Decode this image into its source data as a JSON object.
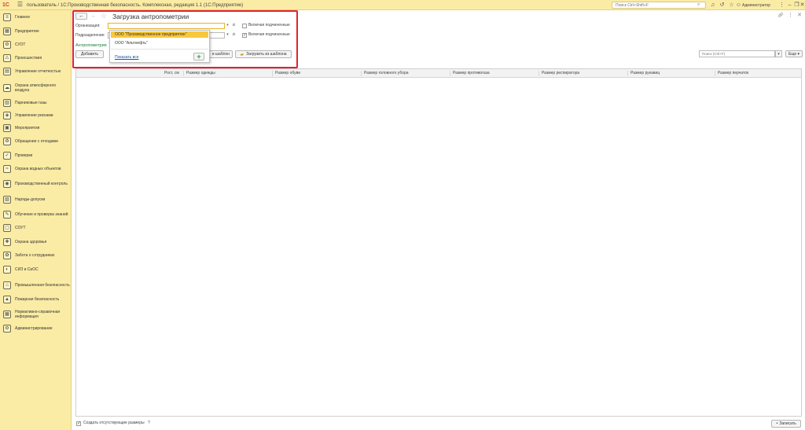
{
  "topbar": {
    "logo": "1С",
    "title": "пользователь / 1С:Производственная безопасность. Комплексная, редакция 1.1  (1С:Предприятие)",
    "search_placeholder": "Поиск Ctrl+Shift+F",
    "user": "Администратор"
  },
  "sidebar": {
    "items": [
      {
        "label": "Главное",
        "icon": "≡"
      },
      {
        "label": "Предприятие",
        "icon": "▦"
      },
      {
        "label": "СУОТ",
        "icon": "⚙"
      },
      {
        "label": "Происшествия",
        "icon": "⚠"
      },
      {
        "label": "Управление отчетностью",
        "icon": "▤"
      },
      {
        "label": "Охрана атмосферного воздуха",
        "icon": "☁"
      },
      {
        "label": "Парниковые газы",
        "icon": "▥"
      },
      {
        "label": "Управление рисками",
        "icon": "◈"
      },
      {
        "label": "Мероприятия",
        "icon": "▣"
      },
      {
        "label": "Обращение с отходами",
        "icon": "♻"
      },
      {
        "label": "Проверки",
        "icon": "✓"
      },
      {
        "label": "Охрана водных объектов",
        "icon": "≈"
      },
      {
        "label": "Производственный контроль",
        "icon": "◉"
      },
      {
        "label": "Наряды-допуски",
        "icon": "▧"
      },
      {
        "label": "Обучение и проверка знаний",
        "icon": "✎"
      },
      {
        "label": "СОУТ",
        "icon": "▢"
      },
      {
        "label": "Охрана здоровья",
        "icon": "✚"
      },
      {
        "label": "Забота о сотрудниках",
        "icon": "✿"
      },
      {
        "label": "СИЗ и СиОС",
        "icon": "◐"
      },
      {
        "label": "Промышленная безопасность",
        "icon": "⌂"
      },
      {
        "label": "Пожарная безопасность",
        "icon": "▲"
      },
      {
        "label": "Нормативно-справочная информация",
        "icon": "▦"
      },
      {
        "label": "Администрирование",
        "icon": "⚙"
      }
    ]
  },
  "form": {
    "title": "Загрузка антропометрии",
    "org_label": "Организация:",
    "org_value": "",
    "dept_label": "Подразделение:",
    "include_sub_1": "Включая подчиненные",
    "include_sub_2": "Включая подчиненные",
    "section_link": "Антропометрия",
    "add_button": "Добавить",
    "save_template": "в шаблон",
    "load_template": "Загрузить из шаблона",
    "table_search_placeholder": "Поиск (Ctrl+F)",
    "more_button": "Еще"
  },
  "dropdown": {
    "items": [
      "ООО \"Производственное предприятие\"",
      "ООО \"Альтнефть\""
    ],
    "show_all": "Показать все",
    "add": "+"
  },
  "table": {
    "columns": [
      "Рост, см",
      "Размер одежды",
      "Размер обуви",
      "Размер головного убора",
      "Размер противогаза",
      "Размер респиратора",
      "Размер рукавиц",
      "Размер перчаток"
    ]
  },
  "footer": {
    "create_missing": "Создать отсутствующие размеры",
    "help": "?",
    "save_button": "Записать"
  }
}
